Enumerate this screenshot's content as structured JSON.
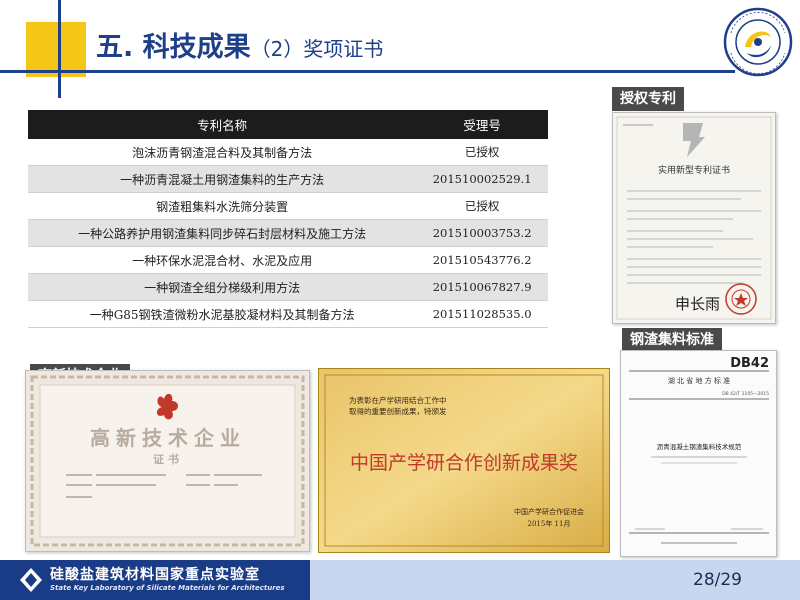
{
  "header": {
    "title_main": "五. 科技成果",
    "title_sub": "（2）奖项证书"
  },
  "table": {
    "headers": [
      "专利名称",
      "受理号"
    ],
    "rows": [
      {
        "name": "泡沫沥青钢渣混合料及其制备方法",
        "number": "已授权"
      },
      {
        "name": "一种沥青混凝土用钢渣集料的生产方法",
        "number": "201510002529.1"
      },
      {
        "name": "钢渣粗集料水洗筛分装置",
        "number": "已授权"
      },
      {
        "name": "一种公路养护用钢渣集料同步碎石封层材料及施工方法",
        "number": "201510003753.2"
      },
      {
        "name": "一种环保水泥混合材、水泥及应用",
        "number": "201510543776.2"
      },
      {
        "name": "一种钢渣全组分梯级利用方法",
        "number": "201510067827.9"
      },
      {
        "name": "一种G85钢铁渣微粉水泥基胶凝材料及其制备方法",
        "number": "201511028535.0"
      }
    ]
  },
  "labels": {
    "patent": "授权专利",
    "standard": "钢渣集料标准",
    "hitech": "高新技术企业"
  },
  "patent_cert": {
    "title": "实用新型专利证书",
    "signature": "申长雨"
  },
  "hitech_cert": {
    "title": "高新技术企业",
    "subtitle": "证书"
  },
  "award_plaque": {
    "top_text_1": "为表彰在产学研用结合工作中",
    "top_text_2": "取得的重要创新成果，特颁发",
    "title": "中国产学研合作创新成果奖",
    "issuer": "中国产学研合作促进会",
    "date": "2015年 11月"
  },
  "standard_doc": {
    "code": "DB42",
    "region": "湖  北  省  地  方  标  准",
    "std_no": "DB 42/T 1105—2015",
    "title": "沥青混凝土钢渣集料技术规范"
  },
  "footer": {
    "lab_name": "硅酸盐建筑材料国家重点实验室",
    "lab_name_en": "State Key Laboratory of Silicate Materials for Architectures",
    "page": "28/29"
  },
  "colors": {
    "brand_blue": "#1e3f8a",
    "accent_yellow": "#f5c518",
    "table_header": "#1c1c1c"
  }
}
